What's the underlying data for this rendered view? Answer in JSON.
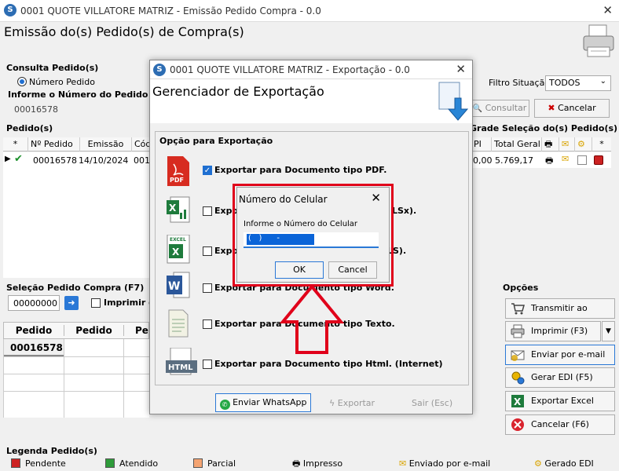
{
  "main": {
    "title": "0001 QUOTE VILLATORE MATRIZ - Emissão Pedido Compra - 0.0",
    "heading": "Emissão do(s) Pedido(s) de Compra(s)",
    "consulta_label": "Consulta Pedido(s)",
    "radio_label": "Número Pedido",
    "informe_label": "Informe o Número do Pedido",
    "pedido_value": "00016578",
    "filtro_label": "Filtro Situação:",
    "filtro_value": "TODOS",
    "consultar_label": "Consultar",
    "cancelar_label": "Cancelar",
    "pedidos_label": "Pedido(s)",
    "grade_label": "Grade Seleção do(s) Pedido(s)",
    "table_headers": [
      "*",
      "Nº Pedido",
      "Emissão",
      "Cód"
    ],
    "right_headers": [
      "PI",
      "Total Geral",
      "*"
    ],
    "row": {
      "num": "00016578",
      "emissao": "14/10/2024",
      "cod": "001",
      "pi": "0,00",
      "total": "5.769,17"
    },
    "selecao_label": "Seleção Pedido Compra (F7)",
    "selecao_value": "00000000",
    "imprimir_label": "Imprimir o",
    "bottom_headers": [
      "Pedido",
      "Pedido",
      "Pe"
    ],
    "bottom_row": "00016578",
    "opcoes_label": "Opções",
    "options": [
      "Transmitir ao Fornec.",
      "Imprimir (F3)",
      "Enviar por e-mail (F4)",
      "Gerar EDI (F5)",
      "Exportar Excel",
      "Cancelar (F6)"
    ],
    "legenda_label": "Legenda Pedido(s)",
    "legend": [
      "Pendente",
      "Atendido",
      "Parcial",
      "Impresso",
      "Enviado por e-mail",
      "Gerado EDI"
    ],
    "colors": {
      "pendente": "#cc2222",
      "atendido": "#2e9b3a",
      "parcial": "#f4a472"
    }
  },
  "export": {
    "title": "0001 QUOTE VILLATORE MATRIZ - Exportação - 0.0",
    "heading": "Gerenciador de Exportação",
    "group_label": "Opção para Exportação",
    "options": [
      "Exportar para Documento tipo PDF.",
      "Expor",
      "LSx).",
      "Expor",
      "LS).",
      "Exportar para Documento tipo Word.",
      "Exportar para Documento tipo Texto.",
      "Exportar para Documento tipo Html. (Internet)"
    ],
    "icons": {
      "pdf": "PDF",
      "excel": "EXCEL",
      "html": "HTML",
      "word": "W"
    },
    "whatsapp_label": "Enviar WhatsApp",
    "exportar_label": "Exportar",
    "sair_label": "Sair (Esc)"
  },
  "celular": {
    "title": "Número do Celular",
    "label": "Informe o Número do Celular",
    "value": "(   )      -",
    "ok_label": "OK",
    "cancel_label": "Cancel"
  }
}
